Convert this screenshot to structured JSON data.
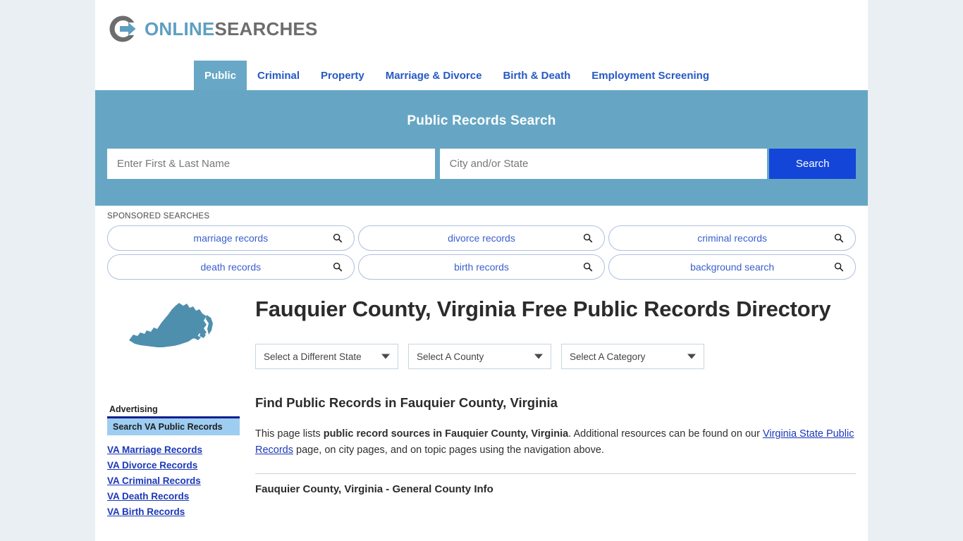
{
  "brand": {
    "word1": "ONLINE",
    "word2": "SEARCHES",
    "logo_icon": "circle-arrow-logo-icon",
    "accent_blue": "#5e9fc0",
    "accent_grey": "#6d6d6d"
  },
  "nav": {
    "tabs": [
      {
        "label": "Public",
        "active": true
      },
      {
        "label": "Criminal",
        "active": false
      },
      {
        "label": "Property",
        "active": false
      },
      {
        "label": "Marriage & Divorce",
        "active": false
      },
      {
        "label": "Birth & Death",
        "active": false
      },
      {
        "label": "Employment Screening",
        "active": false
      }
    ]
  },
  "banner": {
    "title": "Public Records Search",
    "background": "#66a6c4",
    "name_placeholder": "Enter First & Last Name",
    "name_value": "",
    "location_placeholder": "City and/or State",
    "location_value": "",
    "search_label": "Search",
    "search_color": "#1445d9"
  },
  "sponsored": {
    "label": "SPONSORED SEARCHES",
    "icon": "magnifier-icon",
    "items": [
      "marriage records",
      "divorce records",
      "criminal records",
      "death records",
      "birth records",
      "background search"
    ]
  },
  "sidebar": {
    "map_icon": "virginia-state-map-icon",
    "advertising_label": "Advertising",
    "ad_header": "Search VA Public Records",
    "ad_header_bg": "#9ecdf2",
    "links": [
      "VA Marriage Records",
      "VA Divorce Records",
      "VA Criminal Records",
      "VA Death Records",
      "VA Birth Records"
    ]
  },
  "main": {
    "page_title": "Fauquier County, Virginia Free Public Records Directory",
    "selects": [
      {
        "name": "state",
        "value": "Select a Different State"
      },
      {
        "name": "county",
        "value": "Select A County"
      },
      {
        "name": "category",
        "value": "Select A Category"
      }
    ],
    "section_title": "Find Public Records in Fauquier County, Virginia",
    "intro": {
      "part1": "This page lists ",
      "strong": "public record sources in Fauquier County, Virginia",
      "part2": ". Additional resources can be found on our ",
      "link": "Virginia State Public Records",
      "part3": " page, on city pages, and on topic pages using the navigation above."
    },
    "subsection_title": "Fauquier County, Virginia - General County Info"
  }
}
